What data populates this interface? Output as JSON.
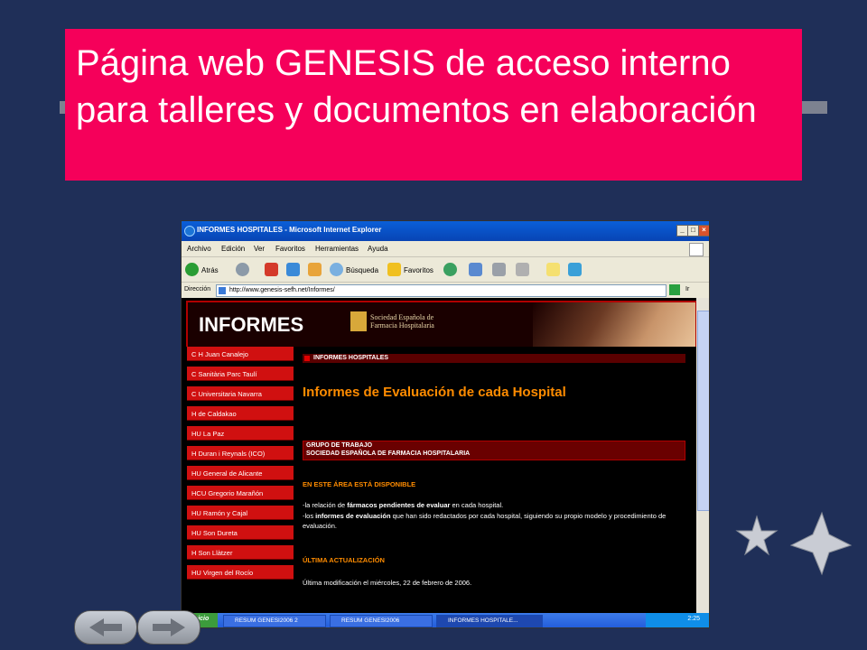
{
  "slide": {
    "title": "Página web GENESIS de acceso interno para talleres y documentos en elaboración",
    "accent_color": "#f5005a",
    "background_color": "#1f2f58"
  },
  "browser": {
    "window_title": "INFORMES HOSPITALES - Microsoft Internet Explorer",
    "menu": [
      "Archivo",
      "Edición",
      "Ver",
      "Favoritos",
      "Herramientas",
      "Ayuda"
    ],
    "toolbar": {
      "back": "Atrás",
      "search": "Búsqueda",
      "favorites": "Favoritos"
    },
    "address_label": "Dirección",
    "address_value": "http://www.genesis-sefh.net/Informes/",
    "go_label": "Ir"
  },
  "webpage": {
    "banner_title": "INFORMES",
    "org_line1": "Sociedad Española de",
    "org_line2": "Farmacia Hospitalaria",
    "nav_items": [
      "C H Juan Canalejo",
      "C Sanitària Parc Taulí",
      "C Universitaria Navarra",
      "H de Caldakao",
      "HU La Paz",
      "H Duran i Reynals (ICO)",
      "HU General de Alicante",
      "HCU Gregorio Marañón",
      "HU Ramón y Cajal",
      "HU Son Dureta",
      "H Son Llàtzer",
      "HU Virgen del Rocío"
    ],
    "section_label": "INFORMES HOSPITALES",
    "main_title": "Informes de Evaluación de cada Hospital",
    "group_line1": "GRUPO DE TRABAJO",
    "group_line2": "SOCIEDAD ESPAÑOLA DE FARMACIA HOSPITALARIA",
    "available_heading": "EN ESTE ÁREA ESTÁ DISPONIBLE",
    "available_line1_pre": "-la relación de ",
    "available_line1_bold": "fármacos pendientes de evaluar",
    "available_line1_post": " en cada hospital.",
    "available_line2_pre": "-los ",
    "available_line2_bold": "informes de evaluación",
    "available_line2_post": " que han sido redactados por cada hospital, siguiendo su propio modelo y procedimiento de evaluación.",
    "update_heading": "ÚLTIMA ACTUALIZACIÓN",
    "update_text": "Última modificación el miércoles, 22 de febrero de 2006."
  },
  "taskbar": {
    "start_label": "Inicio",
    "tasks": [
      "RESUM GENESI2006 2",
      "RESUM GENESI2006",
      "INFORMES HOSPITALE..."
    ],
    "clock": "2:25"
  }
}
